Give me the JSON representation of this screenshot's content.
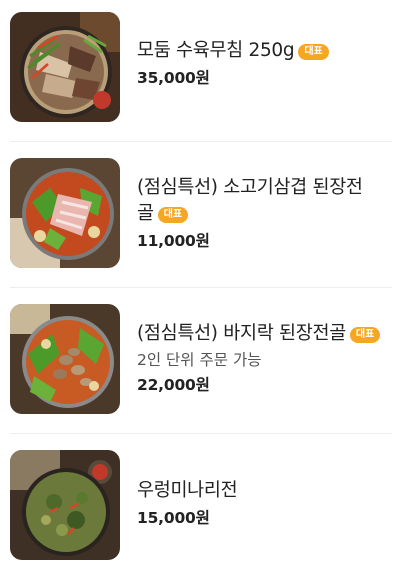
{
  "menu": {
    "items": [
      {
        "name": "모둠 수육무침 250g",
        "name_line2": "",
        "badge": "대표",
        "description": "",
        "price": "35,000원",
        "image_icon": "boiled-pork-salad-dish"
      },
      {
        "name": "(점심특선) 소고기삼겹 된장전",
        "name_line2": "골",
        "badge": "대표",
        "description": "",
        "price": "11,000원",
        "image_icon": "beef-doenjang-hotpot"
      },
      {
        "name": "(점심특선) 바지락 된장전골",
        "name_line2": "",
        "badge": "대표",
        "description": "2인 단위 주문 가능",
        "price": "22,000원",
        "image_icon": "clam-doenjang-hotpot"
      },
      {
        "name": "우렁미나리전",
        "name_line2": "",
        "badge": "",
        "description": "",
        "price": "15,000원",
        "image_icon": "snail-minari-pancake"
      }
    ]
  },
  "colors": {
    "badge": "#f5a623",
    "text": "#222222",
    "subtext": "#555555",
    "divider": "#eeeeee"
  }
}
